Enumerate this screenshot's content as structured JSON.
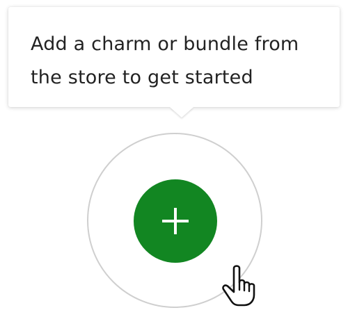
{
  "tooltip": {
    "line1": "Add a charm or bundle from",
    "line2": "the store to get started"
  },
  "add_button": {
    "icon": "plus-icon",
    "color": "#128622",
    "icon_color": "#ffffff"
  },
  "ring": {
    "border_color": "#cfcfcf"
  },
  "cursor": {
    "icon": "hand-pointer-icon"
  }
}
